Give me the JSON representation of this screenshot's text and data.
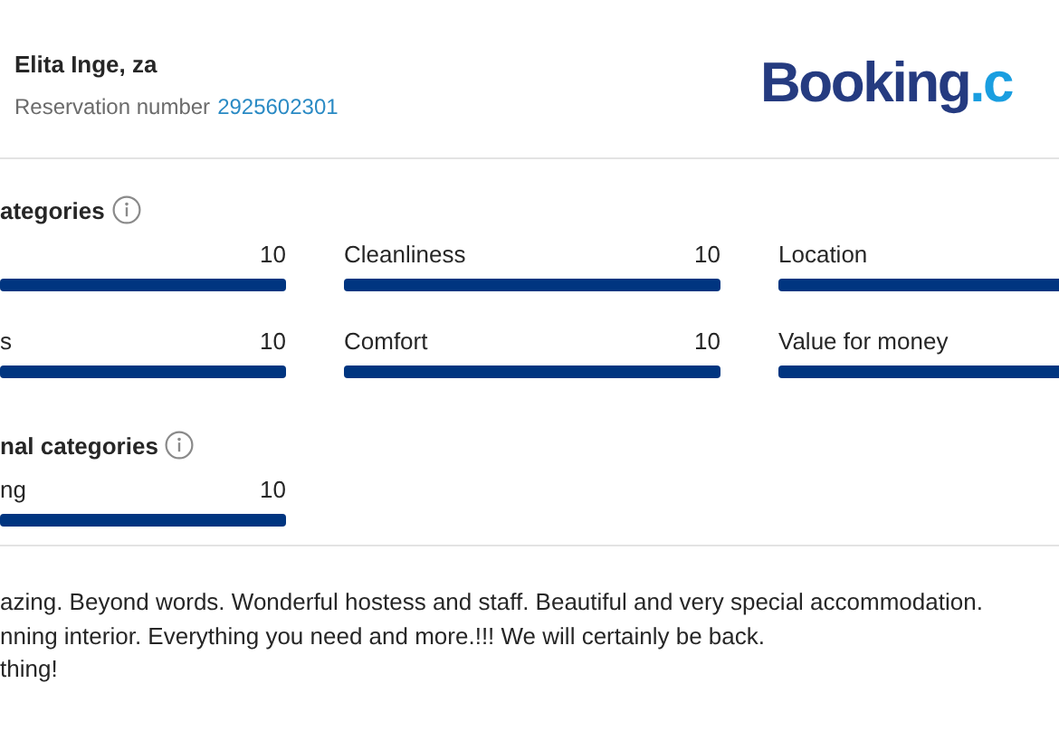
{
  "guest": {
    "name": "Elita Inge, za",
    "reservation_label": "Reservation number",
    "reservation_number": "2925602301"
  },
  "logo": {
    "main": "Booking",
    "suffix": ".c"
  },
  "categories": {
    "title": "ategories",
    "items": [
      {
        "score": "10",
        "level": 1
      },
      {
        "label": "Cleanliness",
        "score": "10",
        "level": 1
      },
      {
        "label": "Location",
        "level": 1
      },
      {
        "label": "s",
        "score": "10",
        "level": 1
      },
      {
        "label": "Comfort",
        "score": "10",
        "level": 1
      },
      {
        "label": "Value for money",
        "level": 1
      }
    ]
  },
  "additional_categories": {
    "title": "nal categories",
    "items": [
      {
        "label": "ng",
        "score": "10",
        "level": 1
      }
    ]
  },
  "review": {
    "lines": [
      "azing. Beyond words. Wonderful hostess and staff. Beautiful and very special accommodation.",
      "nning interior. Everything you need and more.!!! We will certainly be back.",
      "thing!"
    ]
  }
}
